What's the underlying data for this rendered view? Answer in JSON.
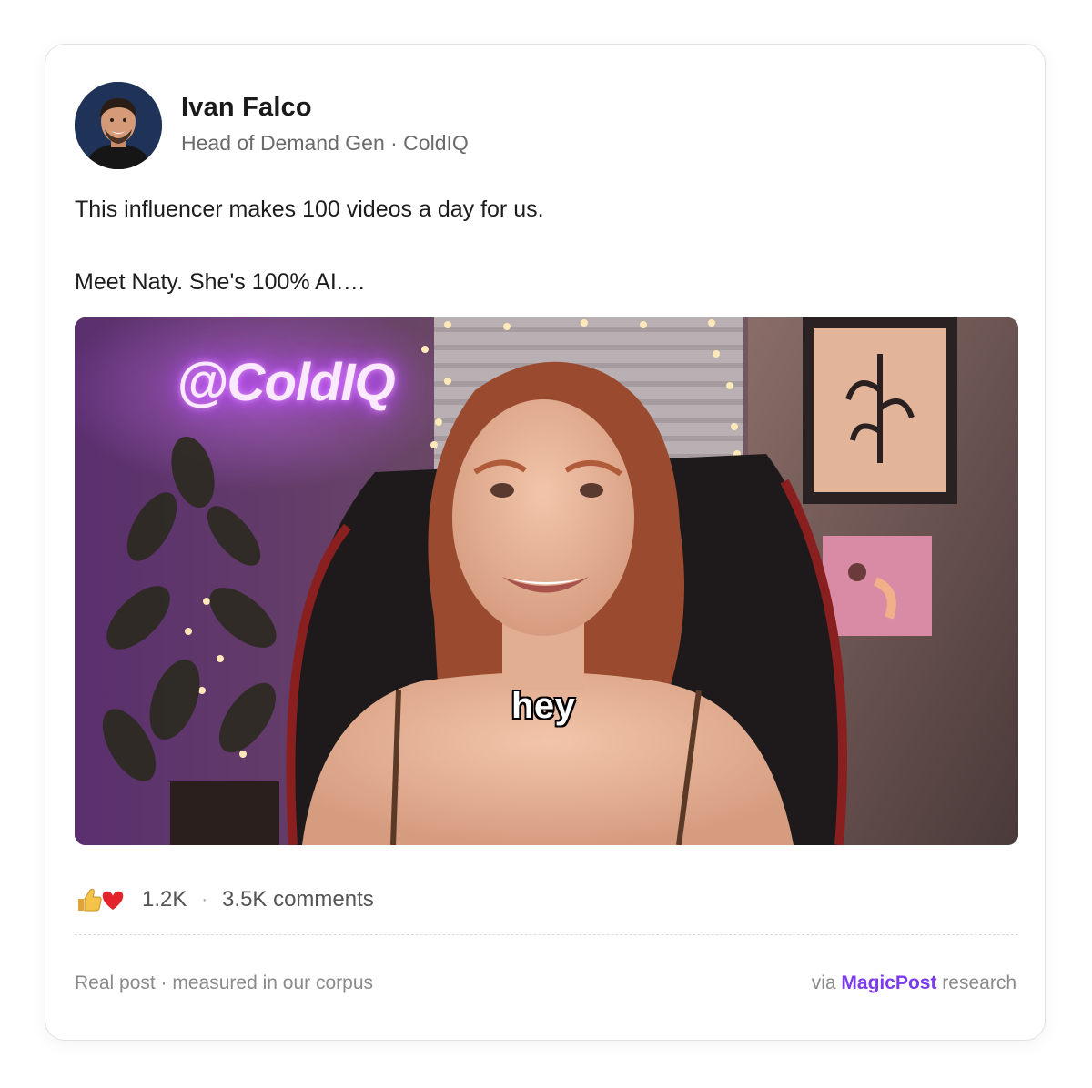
{
  "author": {
    "name": "Ivan Falco",
    "headline": "Head of Demand Gen · ColdIQ"
  },
  "post": {
    "line1": "This influencer makes 100 videos a day for us.",
    "line2": "Meet Naty. She's 100% AI.…"
  },
  "media": {
    "neon_sign": "@ColdIQ",
    "caption": "hey"
  },
  "stats": {
    "reaction_icons": [
      "thumbs-up-icon",
      "heart-icon"
    ],
    "reactions": "1.2K",
    "separator": "·",
    "comments": "3.5K comments"
  },
  "footer": {
    "left": "Real post · measured in our corpus",
    "via": "via",
    "brand": "MagicPost",
    "suffix": "research"
  },
  "colors": {
    "brand": "#7c3aed",
    "neon": "#c050ff",
    "muted_text": "#8a8a8a"
  }
}
